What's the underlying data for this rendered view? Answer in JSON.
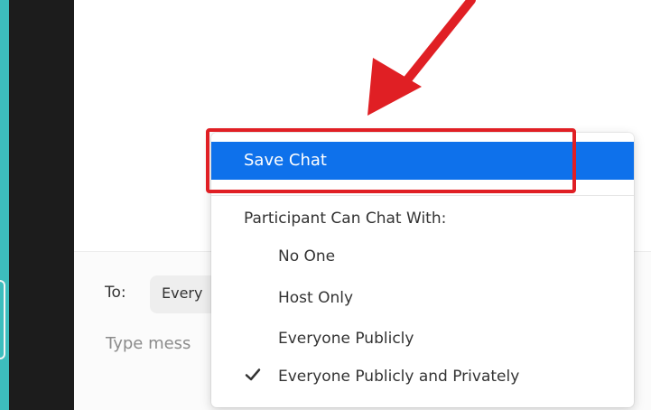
{
  "menu": {
    "save_label": "Save Chat",
    "heading": "Participant Can Chat With:",
    "options": [
      "No One",
      "Host Only",
      "Everyone Publicly",
      "Everyone Publicly and Privately"
    ],
    "selected_option": "Everyone Publicly and Privately"
  },
  "composer": {
    "to_label": "To:",
    "recipient_visible": "Every",
    "placeholder_visible": "Type mess"
  },
  "annotation": {
    "arrow_color": "#e01f24",
    "highlight_color": "#e01f24"
  },
  "colors": {
    "background": "#3dbdbd",
    "accent": "#0e71eb",
    "sidebar": "#1c1c1c"
  }
}
